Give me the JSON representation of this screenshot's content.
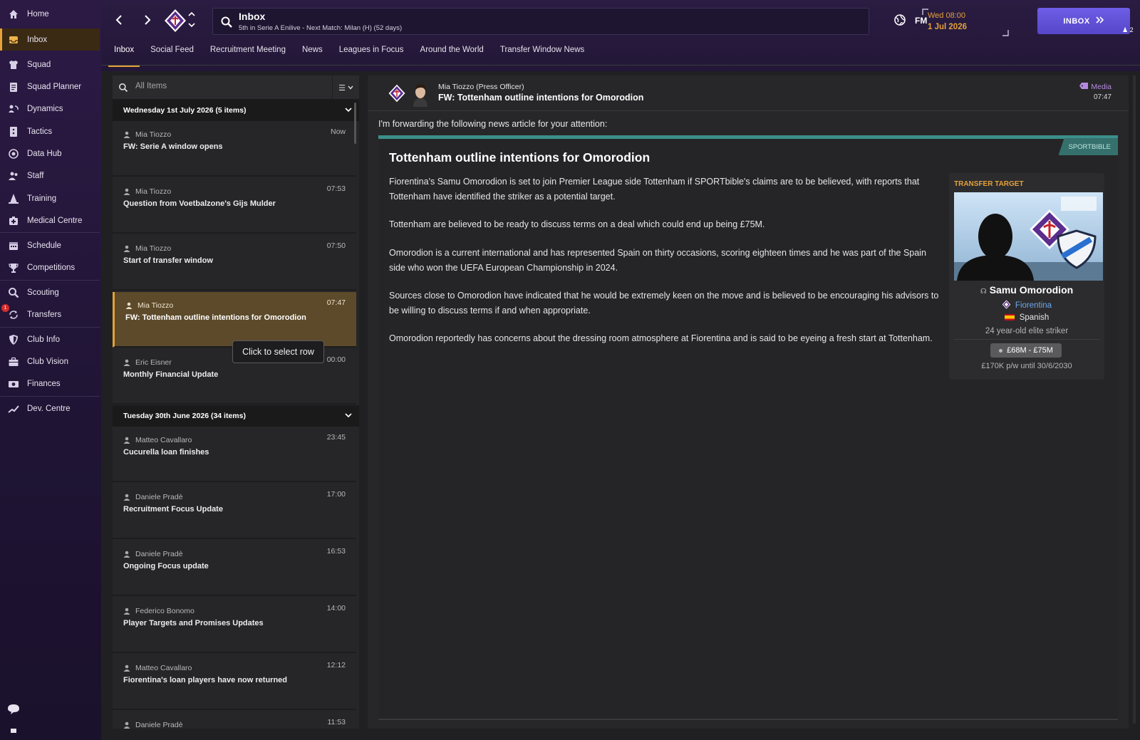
{
  "sidebar": {
    "items": [
      {
        "label": "Home",
        "icon": "home-icon"
      },
      {
        "label": "Inbox",
        "icon": "inbox-icon",
        "active": true
      },
      {
        "label": "Squad",
        "icon": "shirt-icon"
      },
      {
        "label": "Squad Planner",
        "icon": "clipboard-icon"
      },
      {
        "label": "Dynamics",
        "icon": "dynamics-icon"
      },
      {
        "label": "Tactics",
        "icon": "tactics-board-icon"
      },
      {
        "label": "Data Hub",
        "icon": "data-hub-icon"
      },
      {
        "label": "Staff",
        "icon": "staff-icon"
      },
      {
        "label": "Training",
        "icon": "training-cone-icon"
      },
      {
        "label": "Medical Centre",
        "icon": "medical-kit-icon"
      },
      {
        "label": "Schedule",
        "icon": "calendar-icon"
      },
      {
        "label": "Competitions",
        "icon": "trophy-icon"
      },
      {
        "label": "Scouting",
        "icon": "magnifier-icon"
      },
      {
        "label": "Transfers",
        "icon": "transfer-arrows-icon",
        "badge": "1"
      },
      {
        "label": "Club Info",
        "icon": "shield-icon"
      },
      {
        "label": "Club Vision",
        "icon": "briefcase-icon"
      },
      {
        "label": "Finances",
        "icon": "money-icon"
      },
      {
        "label": "Dev. Centre",
        "icon": "growth-icon"
      }
    ]
  },
  "header": {
    "title": "Inbox",
    "subtitle": "5th in Serie A Enilive - Next Match: Milan (H) (52 days)",
    "logo_text": "FM",
    "date_line1": "Wed 08:00",
    "date_line2": "1 Jul 2026",
    "continue_label": "INBOX",
    "users_count": "2",
    "accent_color": "#e5a13a",
    "button_color": "#6251da"
  },
  "tabs": [
    {
      "label": "Inbox",
      "active": true
    },
    {
      "label": "Social Feed"
    },
    {
      "label": "Recruitment Meeting"
    },
    {
      "label": "News"
    },
    {
      "label": "Leagues in Focus"
    },
    {
      "label": "Around the World"
    },
    {
      "label": "Transfer Window News"
    }
  ],
  "list": {
    "search_placeholder": "All Items",
    "groups": [
      {
        "header": "Wednesday 1st July 2026 (5 items)",
        "items": [
          {
            "from": "Mia Tiozzo",
            "time": "Now",
            "subject": "FW: Serie A window opens"
          },
          {
            "from": "Mia Tiozzo",
            "time": "07:53",
            "subject": "Question from Voetbalzone's Gijs Mulder"
          },
          {
            "from": "Mia Tiozzo",
            "time": "07:50",
            "subject": "Start of transfer window"
          },
          {
            "from": "Mia Tiozzo",
            "time": "07:47",
            "subject": "FW: Tottenham outline intentions for Omorodion",
            "selected": true
          },
          {
            "from": "Eric Eisner",
            "time": "00:00",
            "subject": "Monthly Financial Update"
          }
        ]
      },
      {
        "header": "Tuesday 30th June 2026 (34 items)",
        "items": [
          {
            "from": "Matteo Cavallaro",
            "time": "23:45",
            "subject": "Cucurella loan finishes"
          },
          {
            "from": "Daniele Pradè",
            "time": "17:00",
            "subject": "Recruitment Focus Update"
          },
          {
            "from": "Daniele Pradè",
            "time": "16:53",
            "subject": "Ongoing Focus update"
          },
          {
            "from": "Federico Bonomo",
            "time": "14:00",
            "subject": "Player Targets and Promises Updates"
          },
          {
            "from": "Matteo Cavallaro",
            "time": "12:12",
            "subject": "Fiorentina's loan players have now returned"
          },
          {
            "from": "Daniele Pradè",
            "time": "11:53",
            "subject": ""
          }
        ]
      }
    ],
    "tooltip": "Click to select row"
  },
  "message": {
    "sender": "Mia Tiozzo  (Press Officer)",
    "subject": "FW: Tottenham outline intentions for Omorodion",
    "category": "Media",
    "time": "07:47",
    "intro": "I'm forwarding the following news article for your attention:",
    "source": "SPORTBIBLE",
    "headline": "Tottenham outline intentions for Omorodion",
    "paragraphs": [
      "Fiorentina's Samu Omorodion is set to join Premier League side Tottenham if SPORTbible's claims are to be believed, with reports that Tottenham have identified the striker as a potential target.",
      "Tottenham are believed to be ready to discuss terms on a deal which could end up being £75M.",
      "Omorodion is a current international and has represented Spain on thirty occasions, scoring eighteen times and he was part of the Spain side who won the UEFA European Championship in 2024.",
      "Sources close to Omorodion have indicated that he would be extremely keen on the move and is believed to be encouraging his advisors to be willing to discuss terms if and when appropriate.",
      "Omorodion reportedly has concerns about the dressing room atmosphere at Fiorentina and is said to be eyeing a fresh start at Tottenham."
    ],
    "card": {
      "title": "TRANSFER TARGET",
      "player": "Samu Omorodion",
      "club": "Fiorentina",
      "nationality": "Spanish",
      "description": "24 year-old elite striker",
      "fee": "£68M - £75M",
      "wage": "£170K p/w until 30/6/2030"
    }
  }
}
